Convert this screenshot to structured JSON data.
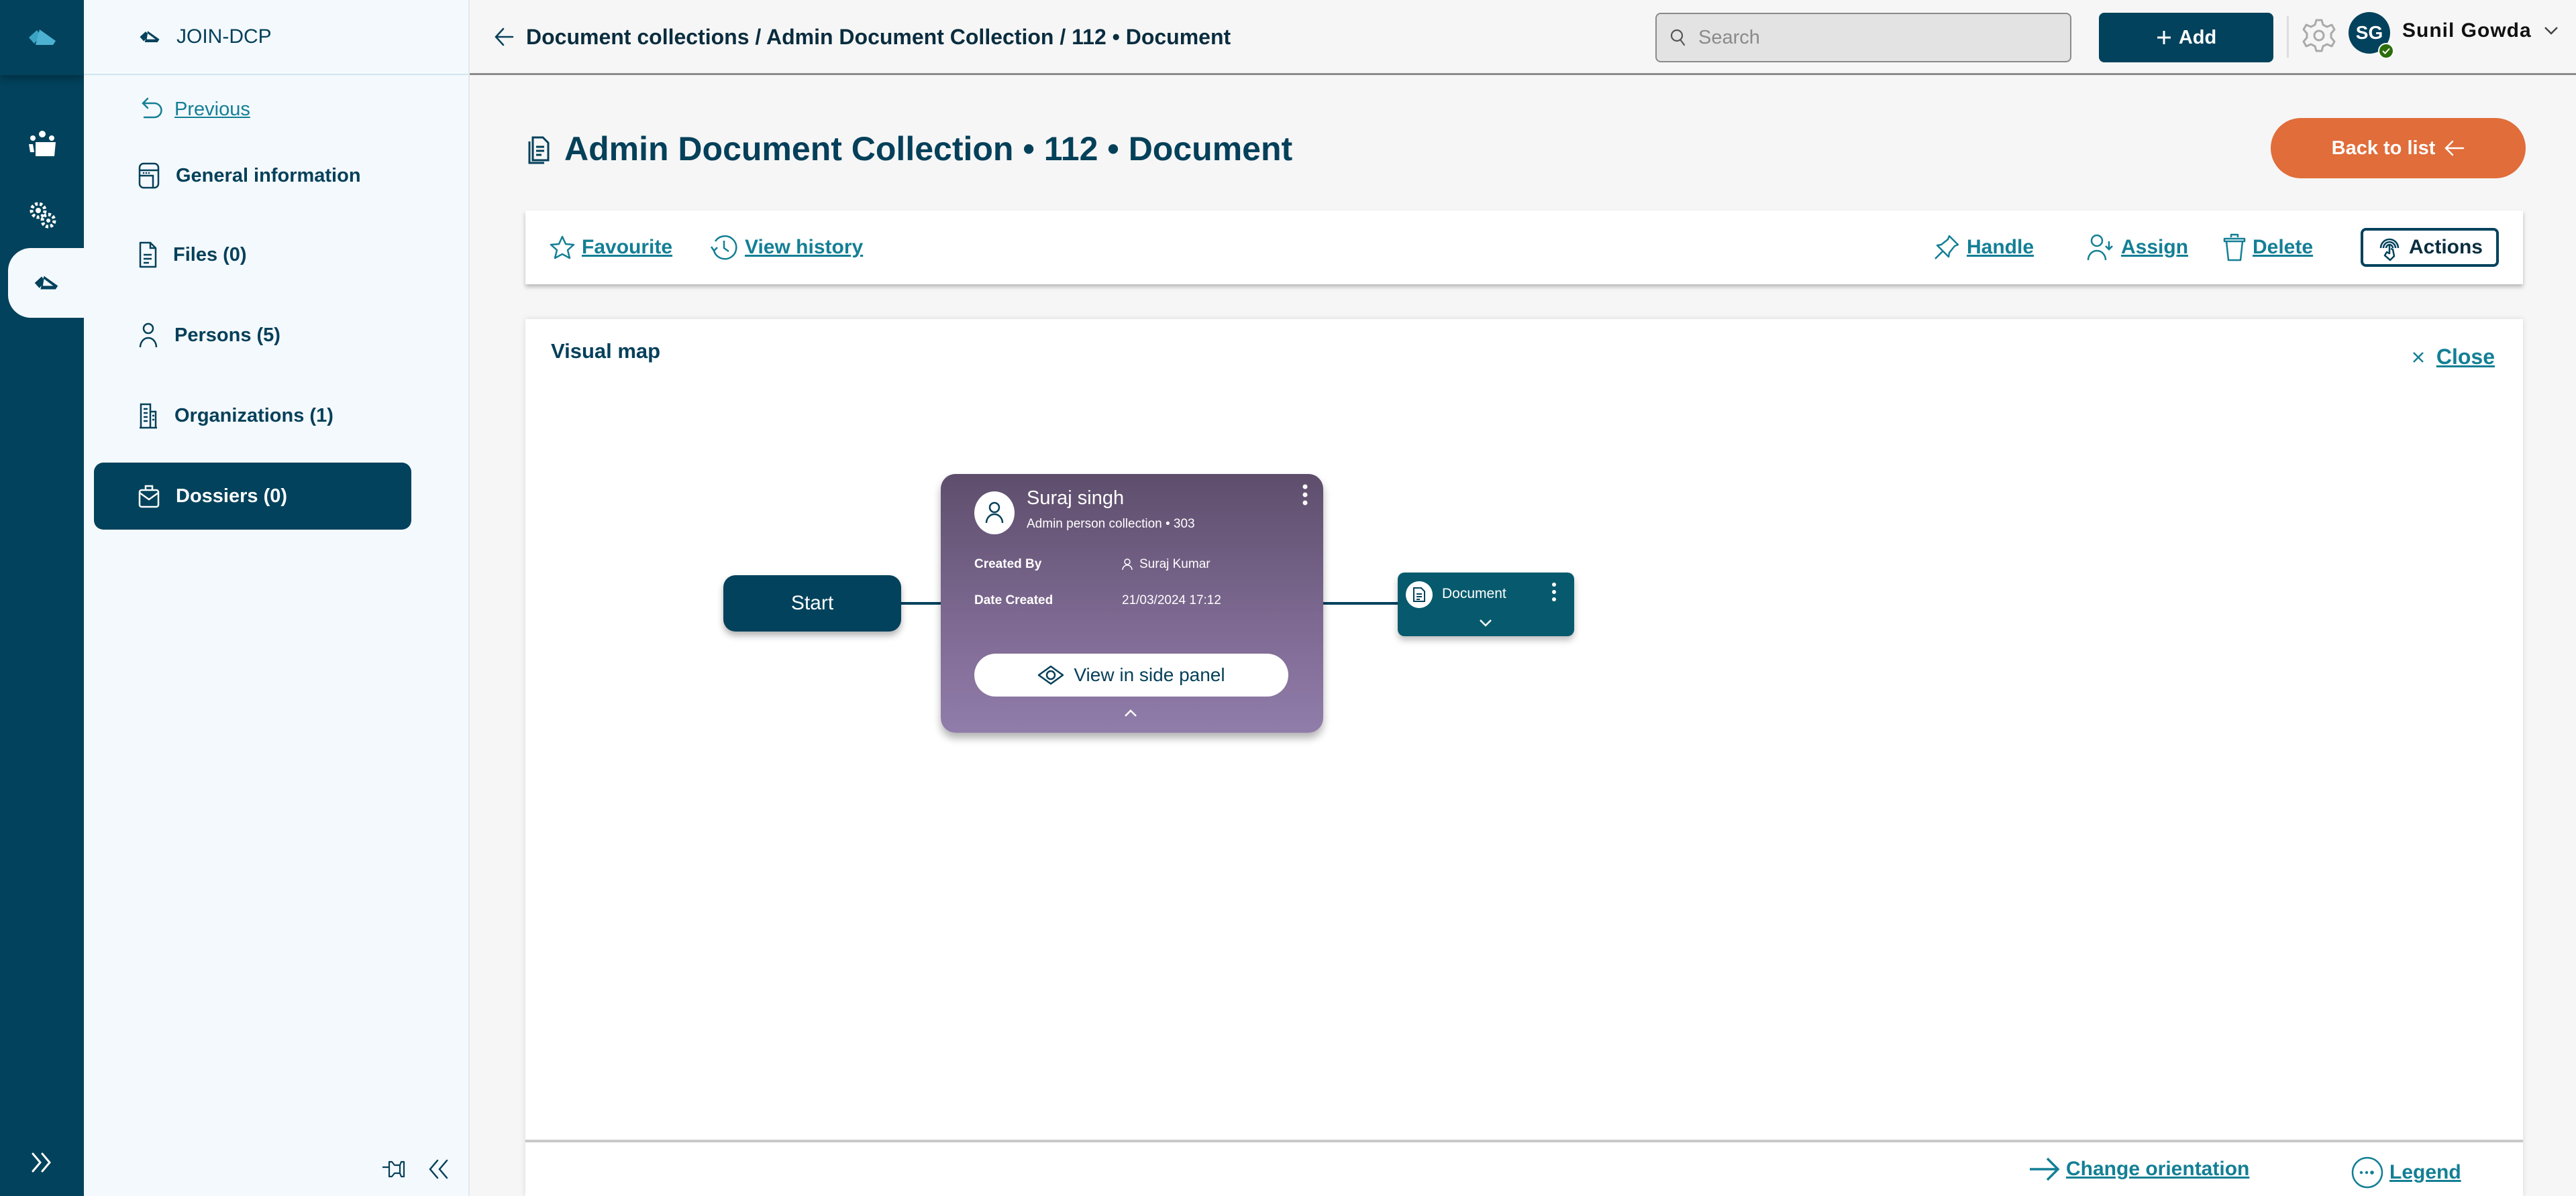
{
  "app": {
    "name": "JOIN-DCP",
    "brand_color": "#02425c",
    "accent_color": "#137f95",
    "orange": "#e06d3a"
  },
  "rail": {
    "items": [
      {
        "icon": "team-icon",
        "label": "Team"
      },
      {
        "icon": "settings-gears-icon",
        "label": "Settings"
      },
      {
        "icon": "join-dcp-logo-icon",
        "label": "JOIN-DCP",
        "active": true
      }
    ],
    "expand_icon": "double-chevron-right-icon"
  },
  "sidebar": {
    "title": "JOIN-DCP",
    "previous_label": "Previous",
    "items": [
      {
        "label": "General information",
        "icon": "general-info-icon"
      },
      {
        "label": "Files (0)",
        "icon": "file-icon"
      },
      {
        "label": "Persons (5)",
        "icon": "person-icon"
      },
      {
        "label": "Organizations (1)",
        "icon": "building-icon"
      },
      {
        "label": "Dossiers (0)",
        "icon": "briefcase-icon",
        "active": true
      }
    ],
    "footer": {
      "pin_icon": "pin-icon",
      "collapse_icon": "double-chevron-left-icon"
    }
  },
  "topbar": {
    "breadcrumb": "Document collections / Admin Document Collection / 112 • Document",
    "search_placeholder": "Search",
    "search_value": "",
    "add_label": "Add",
    "user": {
      "initials": "SG",
      "name": "Sunil Gowda",
      "status": "online"
    }
  },
  "page": {
    "title": "Admin Document Collection • 112 • Document",
    "back_label": "Back to list"
  },
  "toolbar": {
    "favourite": "Favourite",
    "view_history": "View history",
    "handle": "Handle",
    "assign": "Assign",
    "delete": "Delete",
    "actions": "Actions"
  },
  "visual_map": {
    "title": "Visual map",
    "close_label": "Close",
    "nodes": {
      "start": {
        "label": "Start"
      },
      "person": {
        "name": "Suraj singh",
        "subtitle": "Admin person collection • 303",
        "created_by_label": "Created By",
        "created_by_value": "Suraj Kumar",
        "date_created_label": "Date Created",
        "date_created_value": "21/03/2024 17:12",
        "view_button": "View in side panel"
      },
      "document": {
        "label": "Document"
      }
    },
    "footer": {
      "change_orientation": "Change orientation",
      "legend": "Legend"
    }
  }
}
